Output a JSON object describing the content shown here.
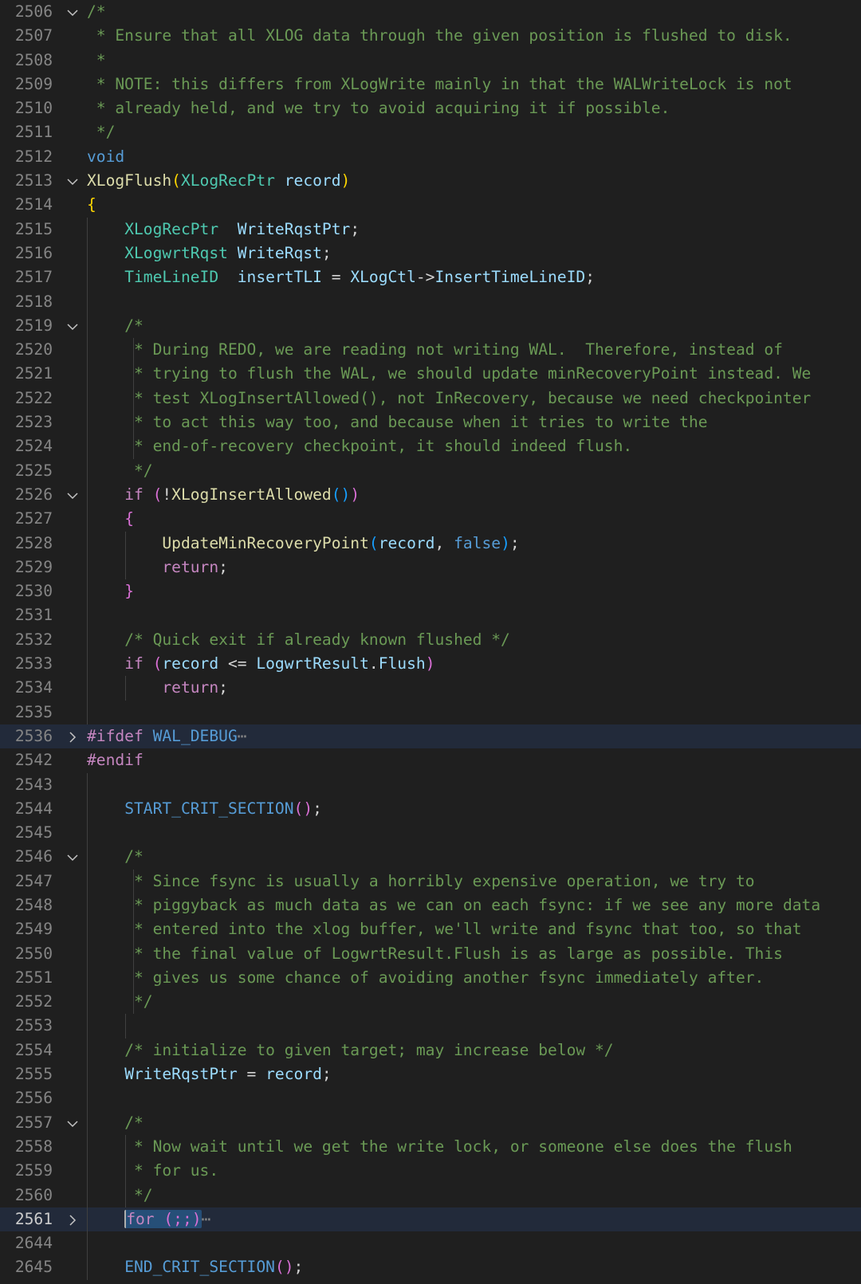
{
  "editor": {
    "language": "c",
    "lines": [
      {
        "num": "2506",
        "fold": "down",
        "guides": [],
        "indent": "",
        "tokens": [
          [
            "/*",
            "c"
          ]
        ]
      },
      {
        "num": "2507",
        "fold": "",
        "guides": [],
        "indent": "",
        "tokens": [
          [
            " * Ensure that all XLOG data through the given position is flushed to disk.",
            "c"
          ]
        ]
      },
      {
        "num": "2508",
        "fold": "",
        "guides": [],
        "indent": "",
        "tokens": [
          [
            " *",
            "c"
          ]
        ]
      },
      {
        "num": "2509",
        "fold": "",
        "guides": [],
        "indent": "",
        "tokens": [
          [
            " * NOTE: this differs from XLogWrite mainly in that the WALWriteLock is not",
            "c"
          ]
        ]
      },
      {
        "num": "2510",
        "fold": "",
        "guides": [],
        "indent": "",
        "tokens": [
          [
            " * already held, and we try to avoid acquiring it if possible.",
            "c"
          ]
        ]
      },
      {
        "num": "2511",
        "fold": "",
        "guides": [],
        "indent": "",
        "tokens": [
          [
            " */",
            "c"
          ]
        ]
      },
      {
        "num": "2512",
        "fold": "",
        "guides": [],
        "indent": "",
        "tokens": [
          [
            "void",
            "k"
          ]
        ]
      },
      {
        "num": "2513",
        "fold": "down",
        "guides": [],
        "indent": "",
        "tokens": [
          [
            "XLogFlush",
            "f"
          ],
          [
            "(",
            "b1"
          ],
          [
            "XLogRecPtr",
            "t"
          ],
          [
            " ",
            "p"
          ],
          [
            "record",
            "v"
          ],
          [
            ")",
            "b1"
          ]
        ]
      },
      {
        "num": "2514",
        "fold": "",
        "guides": [],
        "indent": "",
        "tokens": [
          [
            "{",
            "b1"
          ]
        ]
      },
      {
        "num": "2515",
        "fold": "",
        "guides": [
          "g1"
        ],
        "indent": "    ",
        "tokens": [
          [
            "XLogRecPtr",
            "t"
          ],
          [
            "  ",
            "p"
          ],
          [
            "WriteRqstPtr",
            "v"
          ],
          [
            ";",
            "p"
          ]
        ]
      },
      {
        "num": "2516",
        "fold": "",
        "guides": [
          "g1"
        ],
        "indent": "    ",
        "tokens": [
          [
            "XLogwrtRqst",
            "t"
          ],
          [
            " ",
            "p"
          ],
          [
            "WriteRqst",
            "v"
          ],
          [
            ";",
            "p"
          ]
        ]
      },
      {
        "num": "2517",
        "fold": "",
        "guides": [
          "g1"
        ],
        "indent": "    ",
        "tokens": [
          [
            "TimeLineID",
            "t"
          ],
          [
            "  ",
            "p"
          ],
          [
            "insertTLI",
            "v"
          ],
          [
            " = ",
            "p"
          ],
          [
            "XLogCtl",
            "v"
          ],
          [
            "->",
            "p"
          ],
          [
            "InsertTimeLineID",
            "v"
          ],
          [
            ";",
            "p"
          ]
        ]
      },
      {
        "num": "2518",
        "fold": "",
        "guides": [
          "g1"
        ],
        "indent": "",
        "tokens": []
      },
      {
        "num": "2519",
        "fold": "down",
        "guides": [
          "g1"
        ],
        "indent": "    ",
        "tokens": [
          [
            "/*",
            "c"
          ]
        ]
      },
      {
        "num": "2520",
        "fold": "",
        "guides": [
          "g1",
          "g3"
        ],
        "indent": "    ",
        "tokens": [
          [
            " * During REDO, we are reading not writing WAL.  Therefore, instead of",
            "c"
          ]
        ]
      },
      {
        "num": "2521",
        "fold": "",
        "guides": [
          "g1",
          "g3"
        ],
        "indent": "    ",
        "tokens": [
          [
            " * trying to flush the WAL, we should update minRecoveryPoint instead. We",
            "c"
          ]
        ]
      },
      {
        "num": "2522",
        "fold": "",
        "guides": [
          "g1",
          "g3"
        ],
        "indent": "    ",
        "tokens": [
          [
            " * test XLogInsertAllowed(), not InRecovery, because we need checkpointer",
            "c"
          ]
        ]
      },
      {
        "num": "2523",
        "fold": "",
        "guides": [
          "g1",
          "g3"
        ],
        "indent": "    ",
        "tokens": [
          [
            " * to act this way too, and because when it tries to write the",
            "c"
          ]
        ]
      },
      {
        "num": "2524",
        "fold": "",
        "guides": [
          "g1",
          "g3"
        ],
        "indent": "    ",
        "tokens": [
          [
            " * end-of-recovery checkpoint, it should indeed flush.",
            "c"
          ]
        ]
      },
      {
        "num": "2525",
        "fold": "",
        "guides": [
          "g1"
        ],
        "indent": "    ",
        "tokens": [
          [
            " */",
            "c"
          ]
        ]
      },
      {
        "num": "2526",
        "fold": "down",
        "guides": [
          "g1"
        ],
        "indent": "    ",
        "tokens": [
          [
            "if",
            "kc"
          ],
          [
            " ",
            "p"
          ],
          [
            "(",
            "b2"
          ],
          [
            "!",
            "p"
          ],
          [
            "XLogInsertAllowed",
            "f"
          ],
          [
            "()",
            "b3"
          ],
          [
            ")",
            "b2"
          ]
        ]
      },
      {
        "num": "2527",
        "fold": "",
        "guides": [
          "g1"
        ],
        "indent": "    ",
        "tokens": [
          [
            "{",
            "b2"
          ]
        ]
      },
      {
        "num": "2528",
        "fold": "",
        "guides": [
          "g1",
          "g2"
        ],
        "indent": "        ",
        "tokens": [
          [
            "UpdateMinRecoveryPoint",
            "f"
          ],
          [
            "(",
            "b3"
          ],
          [
            "record",
            "v"
          ],
          [
            ", ",
            "p"
          ],
          [
            "false",
            "k"
          ],
          [
            ")",
            "b3"
          ],
          [
            ";",
            "p"
          ]
        ]
      },
      {
        "num": "2529",
        "fold": "",
        "guides": [
          "g1",
          "g2"
        ],
        "indent": "        ",
        "tokens": [
          [
            "return",
            "kc"
          ],
          [
            ";",
            "p"
          ]
        ]
      },
      {
        "num": "2530",
        "fold": "",
        "guides": [
          "g1"
        ],
        "indent": "    ",
        "tokens": [
          [
            "}",
            "b2"
          ]
        ]
      },
      {
        "num": "2531",
        "fold": "",
        "guides": [
          "g1"
        ],
        "indent": "",
        "tokens": []
      },
      {
        "num": "2532",
        "fold": "",
        "guides": [
          "g1"
        ],
        "indent": "    ",
        "tokens": [
          [
            "/* Quick exit if already known flushed */",
            "c"
          ]
        ]
      },
      {
        "num": "2533",
        "fold": "",
        "guides": [
          "g1"
        ],
        "indent": "    ",
        "tokens": [
          [
            "if",
            "kc"
          ],
          [
            " ",
            "p"
          ],
          [
            "(",
            "b2"
          ],
          [
            "record",
            "v"
          ],
          [
            " <= ",
            "p"
          ],
          [
            "LogwrtResult",
            "v"
          ],
          [
            ".",
            "p"
          ],
          [
            "Flush",
            "v"
          ],
          [
            ")",
            "b2"
          ]
        ]
      },
      {
        "num": "2534",
        "fold": "",
        "guides": [
          "g1",
          "g2"
        ],
        "indent": "        ",
        "tokens": [
          [
            "return",
            "kc"
          ],
          [
            ";",
            "p"
          ]
        ]
      },
      {
        "num": "2535",
        "fold": "",
        "guides": [
          "g1"
        ],
        "indent": "",
        "tokens": []
      },
      {
        "num": "2536",
        "fold": "right",
        "hl": true,
        "guides": [],
        "indent": "",
        "tokens": [
          [
            "#ifdef",
            "kc"
          ],
          [
            " ",
            "p"
          ],
          [
            "WAL_DEBUG",
            "k"
          ],
          [
            "⋯",
            "ell"
          ]
        ]
      },
      {
        "num": "2542",
        "fold": "",
        "guides": [],
        "indent": "",
        "tokens": [
          [
            "#endif",
            "kc"
          ]
        ]
      },
      {
        "num": "2543",
        "fold": "",
        "guides": [
          "g1"
        ],
        "indent": "",
        "tokens": []
      },
      {
        "num": "2544",
        "fold": "",
        "guides": [
          "g1"
        ],
        "indent": "    ",
        "tokens": [
          [
            "START_CRIT_SECTION",
            "k"
          ],
          [
            "()",
            "b2"
          ],
          [
            ";",
            "p"
          ]
        ]
      },
      {
        "num": "2545",
        "fold": "",
        "guides": [
          "g1"
        ],
        "indent": "",
        "tokens": []
      },
      {
        "num": "2546",
        "fold": "down",
        "guides": [
          "g1"
        ],
        "indent": "    ",
        "tokens": [
          [
            "/*",
            "c"
          ]
        ]
      },
      {
        "num": "2547",
        "fold": "",
        "guides": [
          "g1",
          "g3"
        ],
        "indent": "    ",
        "tokens": [
          [
            " * Since fsync is usually a horribly expensive operation, we try to",
            "c"
          ]
        ]
      },
      {
        "num": "2548",
        "fold": "",
        "guides": [
          "g1",
          "g3"
        ],
        "indent": "    ",
        "tokens": [
          [
            " * piggyback as much data as we can on each fsync: if we see any more data",
            "c"
          ]
        ]
      },
      {
        "num": "2549",
        "fold": "",
        "guides": [
          "g1",
          "g3"
        ],
        "indent": "    ",
        "tokens": [
          [
            " * entered into the xlog buffer, we'll write and fsync that too, so that",
            "c"
          ]
        ]
      },
      {
        "num": "2550",
        "fold": "",
        "guides": [
          "g1",
          "g3"
        ],
        "indent": "    ",
        "tokens": [
          [
            " * the final value of LogwrtResult.Flush is as large as possible. This",
            "c"
          ]
        ]
      },
      {
        "num": "2551",
        "fold": "",
        "guides": [
          "g1",
          "g3"
        ],
        "indent": "    ",
        "tokens": [
          [
            " * gives us some chance of avoiding another fsync immediately after.",
            "c"
          ]
        ]
      },
      {
        "num": "2552",
        "fold": "",
        "guides": [
          "g1",
          "g3"
        ],
        "indent": "    ",
        "tokens": [
          [
            " */",
            "c"
          ]
        ]
      },
      {
        "num": "2553",
        "fold": "",
        "guides": [
          "g1",
          "g2"
        ],
        "indent": "",
        "tokens": []
      },
      {
        "num": "2554",
        "fold": "",
        "guides": [
          "g1"
        ],
        "indent": "    ",
        "tokens": [
          [
            "/* initialize to given target; may increase below */",
            "c"
          ]
        ]
      },
      {
        "num": "2555",
        "fold": "",
        "guides": [
          "g1"
        ],
        "indent": "    ",
        "tokens": [
          [
            "WriteRqstPtr",
            "v"
          ],
          [
            " = ",
            "p"
          ],
          [
            "record",
            "v"
          ],
          [
            ";",
            "p"
          ]
        ]
      },
      {
        "num": "2556",
        "fold": "",
        "guides": [
          "g1"
        ],
        "indent": "",
        "tokens": []
      },
      {
        "num": "2557",
        "fold": "down",
        "guides": [
          "g1"
        ],
        "indent": "    ",
        "tokens": [
          [
            "/*",
            "c"
          ]
        ]
      },
      {
        "num": "2558",
        "fold": "",
        "guides": [
          "g1",
          "g2"
        ],
        "indent": "    ",
        "tokens": [
          [
            " * Now wait until we get the write lock, or someone else does the flush",
            "c"
          ]
        ]
      },
      {
        "num": "2559",
        "fold": "",
        "guides": [
          "g1",
          "g2"
        ],
        "indent": "    ",
        "tokens": [
          [
            " * for us.",
            "c"
          ]
        ]
      },
      {
        "num": "2560",
        "fold": "",
        "guides": [
          "g1",
          "g2"
        ],
        "indent": "    ",
        "tokens": [
          [
            " */",
            "c"
          ]
        ]
      },
      {
        "num": "2561",
        "fold": "right",
        "hl": true,
        "current": true,
        "selected": true,
        "guides": [
          "g1"
        ],
        "indent": "    ",
        "tokens": [
          [
            "for",
            "kc"
          ],
          [
            " ",
            "p"
          ],
          [
            "(;;)",
            "b2"
          ],
          [
            "⋯",
            "ell"
          ]
        ]
      },
      {
        "num": "2644",
        "fold": "",
        "guides": [
          "g1"
        ],
        "indent": "",
        "tokens": []
      },
      {
        "num": "2645",
        "fold": "",
        "guides": [
          "g1"
        ],
        "indent": "    ",
        "tokens": [
          [
            "END_CRIT_SECTION",
            "k"
          ],
          [
            "()",
            "b2"
          ],
          [
            ";",
            "p"
          ]
        ]
      }
    ]
  }
}
